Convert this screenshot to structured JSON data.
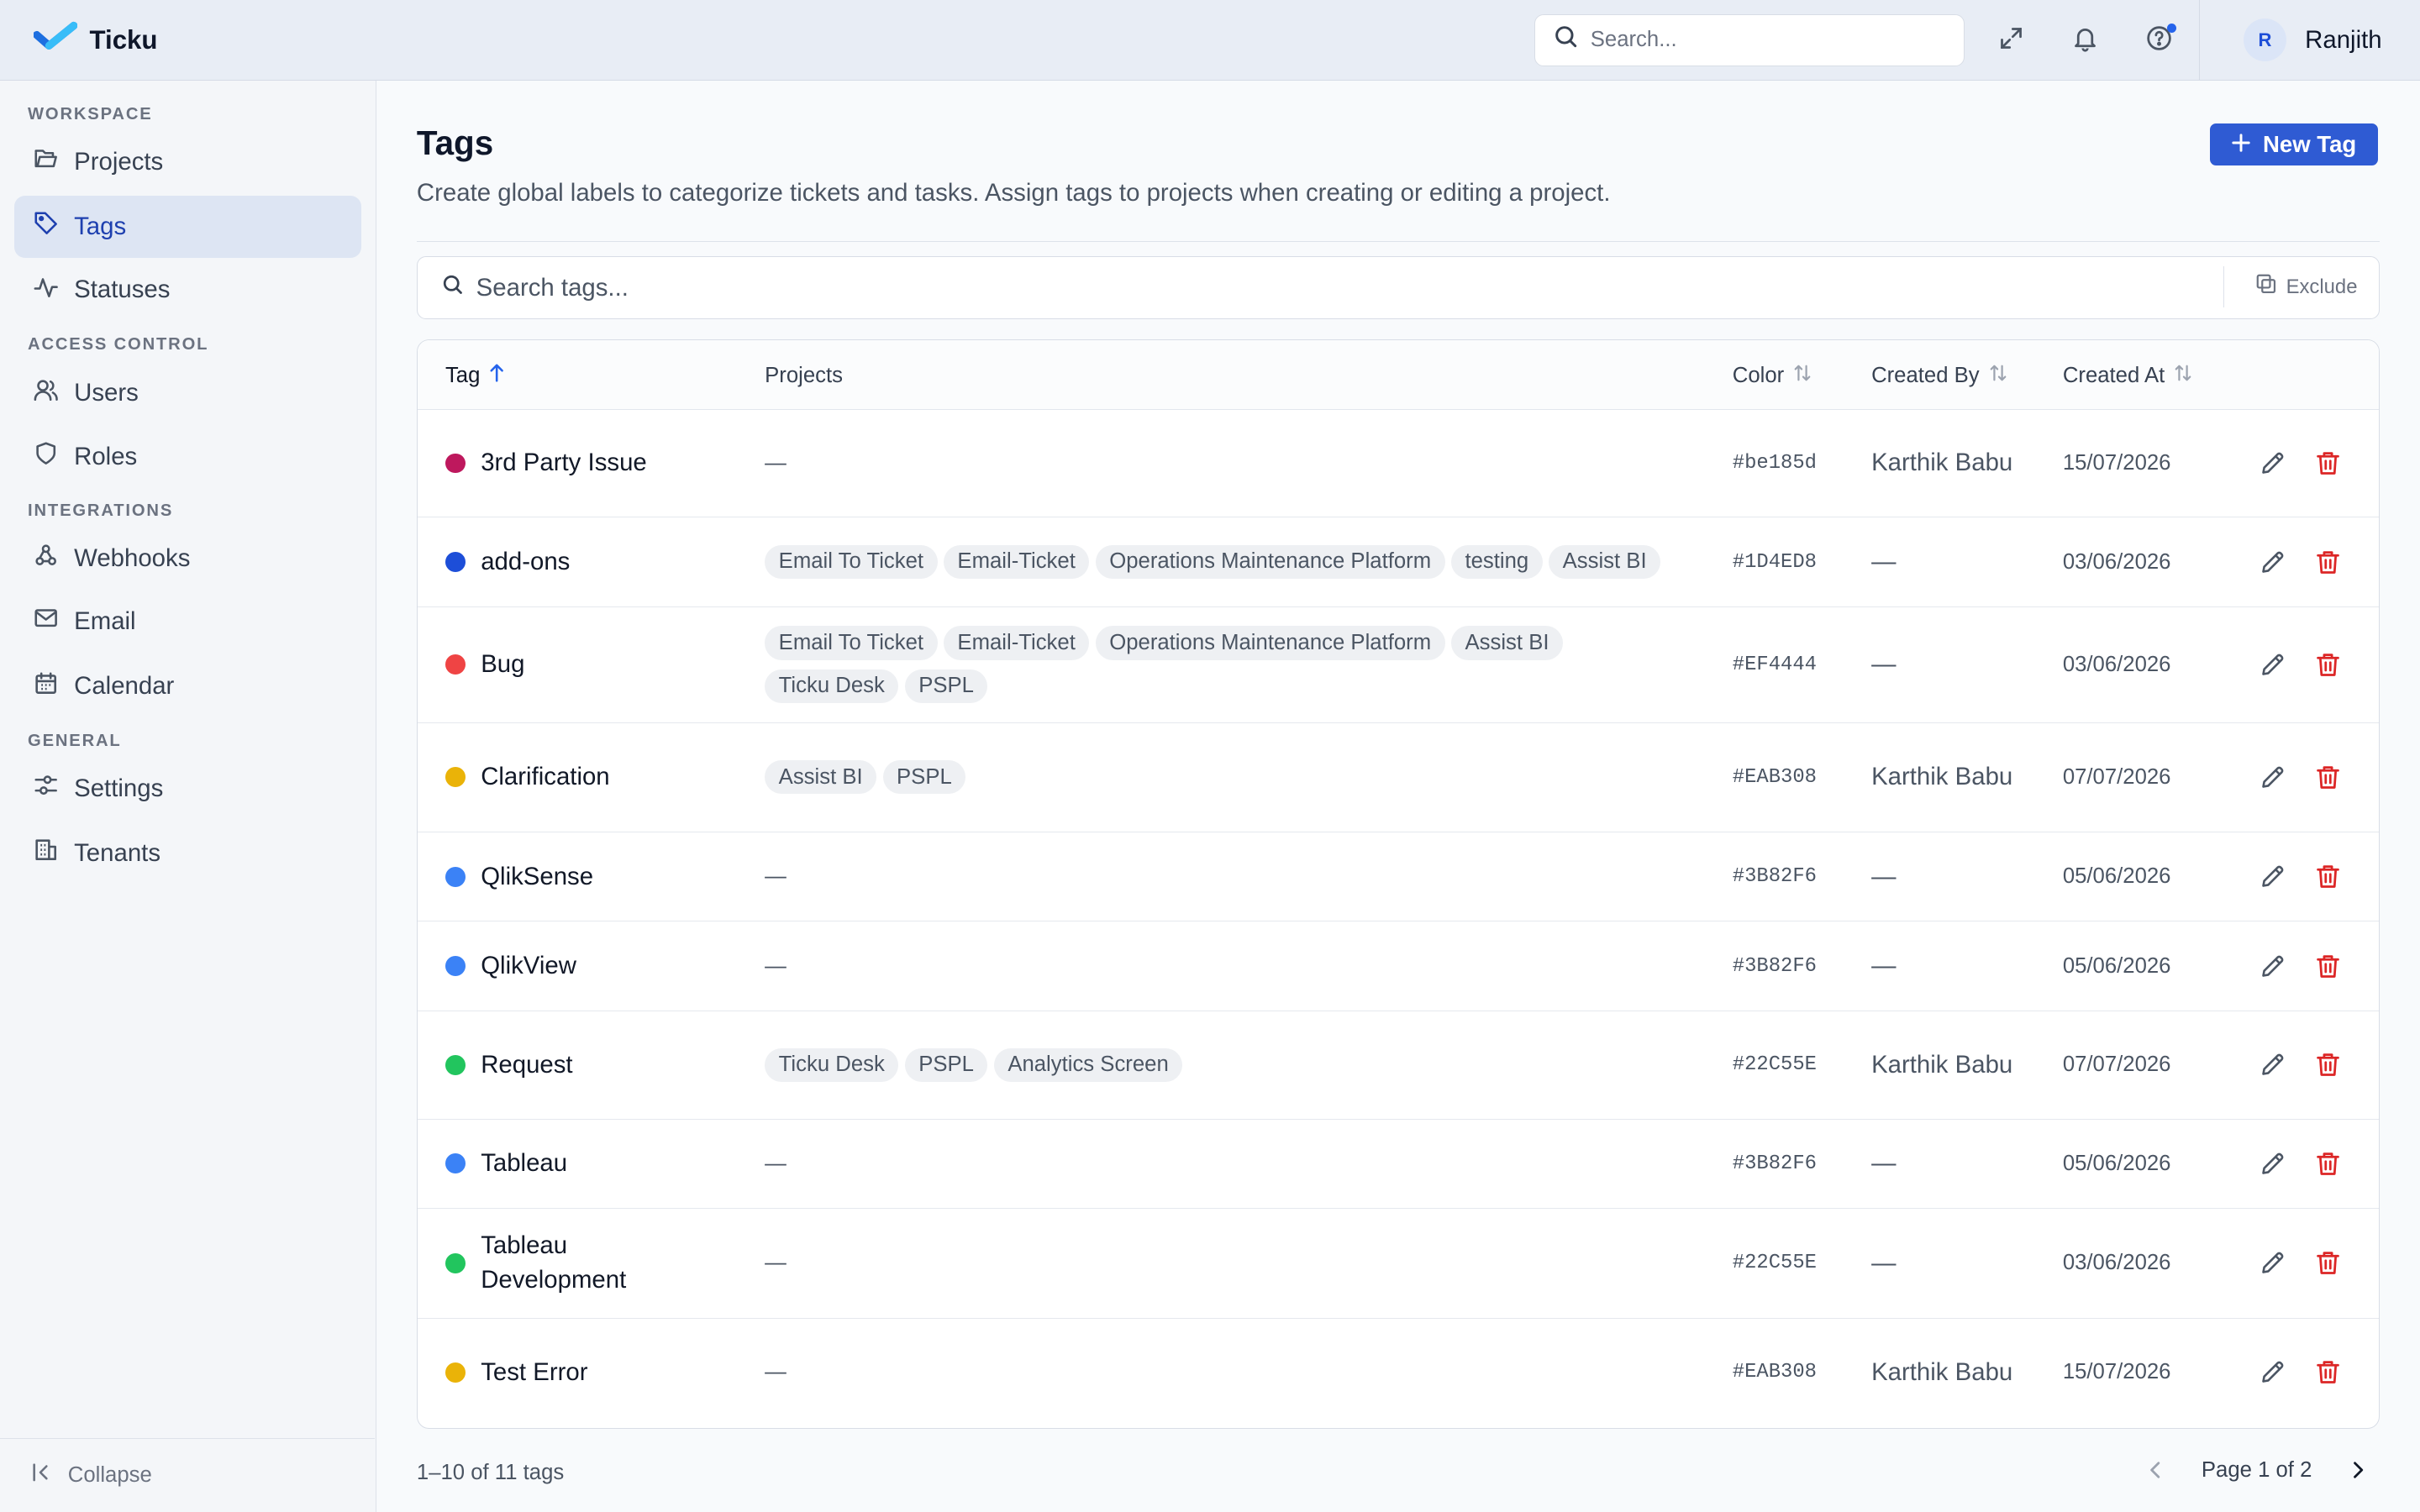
{
  "app": {
    "name": "Ticku"
  },
  "topbar": {
    "search_placeholder": "Search...",
    "user_initial": "R",
    "user_name": "Ranjith"
  },
  "sidebar": {
    "sections": {
      "workspace": "WORKSPACE",
      "access_control": "ACCESS CONTROL",
      "integrations": "INTEGRATIONS",
      "general": "GENERAL"
    },
    "items": {
      "projects": "Projects",
      "tags": "Tags",
      "statuses": "Statuses",
      "users": "Users",
      "roles": "Roles",
      "webhooks": "Webhooks",
      "email": "Email",
      "calendar": "Calendar",
      "settings": "Settings",
      "tenants": "Tenants"
    },
    "collapse": "Collapse"
  },
  "page": {
    "title": "Tags",
    "description": "Create global labels to categorize tickets and tasks. Assign tags to projects when creating or editing a project.",
    "new_button": "New Tag",
    "search_placeholder": "Search tags...",
    "exclude": "Exclude"
  },
  "table": {
    "columns": {
      "tag": "Tag",
      "projects": "Projects",
      "color": "Color",
      "created_by": "Created By",
      "created_at": "Created At"
    },
    "rows": [
      {
        "name": "3rd Party Issue",
        "color": "#be185d",
        "projects": [],
        "created_by": "Karthik Babu",
        "created_at": "15/07/2026"
      },
      {
        "name": "add-ons",
        "color": "#1D4ED8",
        "projects": [
          "Email To Ticket",
          "Email-Ticket",
          "Operations Maintenance Platform",
          "testing",
          "Assist BI"
        ],
        "created_by": "—",
        "created_at": "03/06/2026"
      },
      {
        "name": "Bug",
        "color": "#EF4444",
        "projects": [
          "Email To Ticket",
          "Email-Ticket",
          "Operations Maintenance Platform",
          "Assist BI",
          "Ticku Desk",
          "PSPL"
        ],
        "created_by": "—",
        "created_at": "03/06/2026"
      },
      {
        "name": "Clarification",
        "color": "#EAB308",
        "projects": [
          "Assist BI",
          "PSPL"
        ],
        "created_by": "Karthik Babu",
        "created_at": "07/07/2026"
      },
      {
        "name": "QlikSense",
        "color": "#3B82F6",
        "projects": [],
        "created_by": "—",
        "created_at": "05/06/2026"
      },
      {
        "name": "QlikView",
        "color": "#3B82F6",
        "projects": [],
        "created_by": "—",
        "created_at": "05/06/2026"
      },
      {
        "name": "Request",
        "color": "#22C55E",
        "projects": [
          "Ticku Desk",
          "PSPL",
          "Analytics Screen"
        ],
        "created_by": "Karthik Babu",
        "created_at": "07/07/2026"
      },
      {
        "name": "Tableau",
        "color": "#3B82F6",
        "projects": [],
        "created_by": "—",
        "created_at": "05/06/2026"
      },
      {
        "name": "Tableau Development",
        "color": "#22C55E",
        "projects": [],
        "created_by": "—",
        "created_at": "03/06/2026"
      },
      {
        "name": "Test Error",
        "color": "#EAB308",
        "projects": [],
        "created_by": "Karthik Babu",
        "created_at": "15/07/2026"
      }
    ],
    "empty_dash": "—"
  },
  "footer": {
    "count": "1–10 of 11 tags",
    "page": "Page 1 of 2"
  },
  "colors": {
    "accent": "#2f5bd3",
    "delete": "#dc2626"
  }
}
